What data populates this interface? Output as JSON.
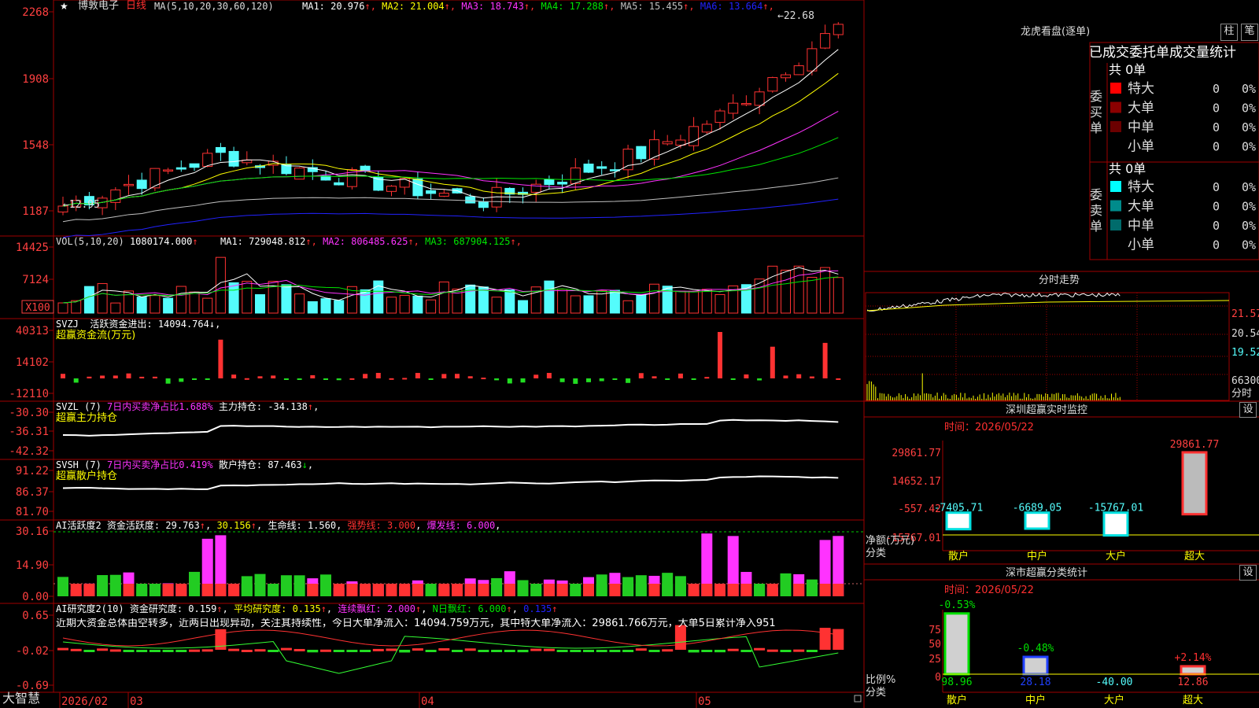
{
  "colors": {
    "up": "#ff3232",
    "down": "#54fcfc",
    "grid": "#a00000",
    "white": "#ffffff",
    "yellow": "#ffff00",
    "magenta": "#ff33ff",
    "green": "#00e600",
    "gray": "#c0c0c0",
    "blue": "#2222ff"
  },
  "title_bar": {
    "star": "★",
    "stock_name": "博敦电子",
    "period": "日线"
  },
  "price_panel": {
    "ma_params": "MA(5,10,20,30,60,120)",
    "ma_values": [
      {
        "label": "MA1:",
        "value": "20.976",
        "arrow": "↑",
        "color": "#ffffff"
      },
      {
        "label": "MA2:",
        "value": "21.004",
        "arrow": "↑",
        "color": "#ffff00"
      },
      {
        "label": "MA3:",
        "value": "18.743",
        "arrow": "↑",
        "color": "#ff33ff"
      },
      {
        "label": "MA4:",
        "value": "17.288",
        "arrow": "↑",
        "color": "#00e600"
      },
      {
        "label": "MA5:",
        "value": "15.455",
        "arrow": "↑",
        "color": "#c0c0c0"
      },
      {
        "label": "MA6:",
        "value": "13.664",
        "arrow": "↑",
        "color": "#2222ff"
      }
    ],
    "y_ticks": [
      "2268",
      "1908",
      "1548",
      "1187"
    ],
    "high_label": "22.68",
    "low_label": "12.95"
  },
  "vol_panel": {
    "header": "VOL(5,10,20)",
    "value": "1080174.000",
    "ma_values": [
      {
        "label": "MA1:",
        "value": "729048.812",
        "arrow": "↑",
        "color": "#ffffff"
      },
      {
        "label": "MA2:",
        "value": "806485.625",
        "arrow": "↑",
        "color": "#ff33ff"
      },
      {
        "label": "MA3:",
        "value": "687904.125",
        "arrow": "↑",
        "color": "#00e600"
      }
    ],
    "y_ticks": [
      "14425",
      "7124"
    ],
    "unit": "X100"
  },
  "svzj_panel": {
    "header": "SVZJ",
    "label": "活跃资金进出:",
    "value": "14094.764",
    "arrow": "↓",
    "subtitle": "超赢资金流(万元)",
    "y_ticks": [
      "40313",
      "14102",
      "-12110"
    ]
  },
  "svzl_panel": {
    "header": "SVZL (7)",
    "ratio": "7日内买卖净占比1.688%",
    "label": "主力持仓:",
    "value": "-34.138",
    "arrow": "↑",
    "subtitle": "超赢主力持仓",
    "y_ticks": [
      "-30.30",
      "-36.31",
      "-42.32"
    ]
  },
  "svsh_panel": {
    "header": "SVSH (7)",
    "ratio": "7日内买卖净占比0.419%",
    "label": "散户持仓:",
    "value": "87.463",
    "arrow": "↓",
    "subtitle": "超赢散户持仓",
    "y_ticks": [
      "91.22",
      "86.37",
      "81.70"
    ]
  },
  "ai_active_panel": {
    "header": "AI活跃度2",
    "label": "资金活跃度:",
    "value": "29.763",
    "arrow": "↑",
    "v2": "30.156",
    "life_label": "生命线:",
    "life": "1.560",
    "strong_label": "强势线:",
    "strong": "3.000",
    "burst_label": "爆发线:",
    "burst": "6.000",
    "y_ticks": [
      "30.16",
      "14.90",
      "0.00"
    ]
  },
  "ai_research_panel": {
    "header": "AI研究度2(10)",
    "label": "资金研究度:",
    "value": "0.159",
    "arrow": "↑",
    "avg_label": "平均研究度:",
    "avg": "0.135",
    "cont_label": "连续飘红:",
    "cont": "2.000",
    "n_label": "N日飘红:",
    "n": "6.000",
    "last": "0.135",
    "commentary": "近期大资金总体由空转多，近两日出现异动，关注其持续性，今日大单净流入：14094.759万元，其中特大单净流入：29861.766万元，大单5日累计净入951",
    "y_ticks": [
      "0.65",
      "-0.02",
      "-0.69"
    ]
  },
  "x_axis": {
    "brand": "大智慧",
    "labels": [
      "2026/02",
      "03",
      "04",
      "05"
    ]
  },
  "dragon_tiger": {
    "title": "龙虎看盘(逐单)",
    "btn_bar": "柱",
    "btn_pen": "笔",
    "tabs": [
      "已成交",
      "委托单",
      "成交量统计"
    ],
    "buy": {
      "side": "委买单",
      "total": "共 0单",
      "rows": [
        {
          "name": "特大",
          "count": "0",
          "pct": "0%",
          "color": "#ff0000"
        },
        {
          "name": "大单",
          "count": "0",
          "pct": "0%",
          "color": "#8b0000"
        },
        {
          "name": "中单",
          "count": "0",
          "pct": "0%",
          "color": "#6b0000"
        },
        {
          "name": "小单",
          "count": "0",
          "pct": "0%",
          "color": "#000000"
        }
      ]
    },
    "sell": {
      "side": "委卖单",
      "total": "共 0单",
      "rows": [
        {
          "name": "特大",
          "count": "0",
          "pct": "0%",
          "color": "#00ffff"
        },
        {
          "name": "大单",
          "count": "0",
          "pct": "0%",
          "color": "#008b8b"
        },
        {
          "name": "中单",
          "count": "0",
          "pct": "0%",
          "color": "#006b6b"
        },
        {
          "name": "小单",
          "count": "0",
          "pct": "0%",
          "color": "#000000"
        }
      ]
    }
  },
  "intraday": {
    "title": "分时走势",
    "y_ticks": [
      "21.57",
      "20.54",
      "19.52"
    ],
    "vol_tick": "66300",
    "vol_label": "分时"
  },
  "sz_monitor": {
    "title": "深圳超赢实时监控",
    "btn": "设",
    "date_label": "时间：",
    "date": "2026/05/22",
    "y_ticks": [
      "29861.77",
      "14652.17",
      "-557.42",
      "-15767.01"
    ],
    "axis_label": "净额(万元)",
    "class_label": "分类",
    "bars": [
      {
        "cat": "散户",
        "value": -7405.71,
        "label": "-7405.71"
      },
      {
        "cat": "中户",
        "value": -6689.05,
        "label": "-6689.05"
      },
      {
        "cat": "大户",
        "value": -15767.01,
        "label": "-15767.01"
      },
      {
        "cat": "超大",
        "value": 29861.77,
        "label": "29861.77"
      }
    ]
  },
  "sz_class": {
    "title": "深市超赢分类统计",
    "btn": "设",
    "date_label": "时间：",
    "date": "2026/05/22",
    "y_ticks": [
      "75",
      "50",
      "25",
      "0"
    ],
    "axis_label": "比例%",
    "class_label": "分类",
    "bars": [
      {
        "cat": "散户",
        "value": 98.96,
        "label": "98.96",
        "change": "-0.53%",
        "color": "#00e000"
      },
      {
        "cat": "中户",
        "value": 28.18,
        "label": "28.18",
        "change": "-0.48%",
        "color": "#2040ff"
      },
      {
        "cat": "大户",
        "value": -40.0,
        "label": "-40.00",
        "change": "",
        "color": "#ffff00"
      },
      {
        "cat": "超大",
        "value": 12.86,
        "label": "12.86",
        "change": "+2.14%",
        "color": "#ff3030"
      }
    ]
  }
}
